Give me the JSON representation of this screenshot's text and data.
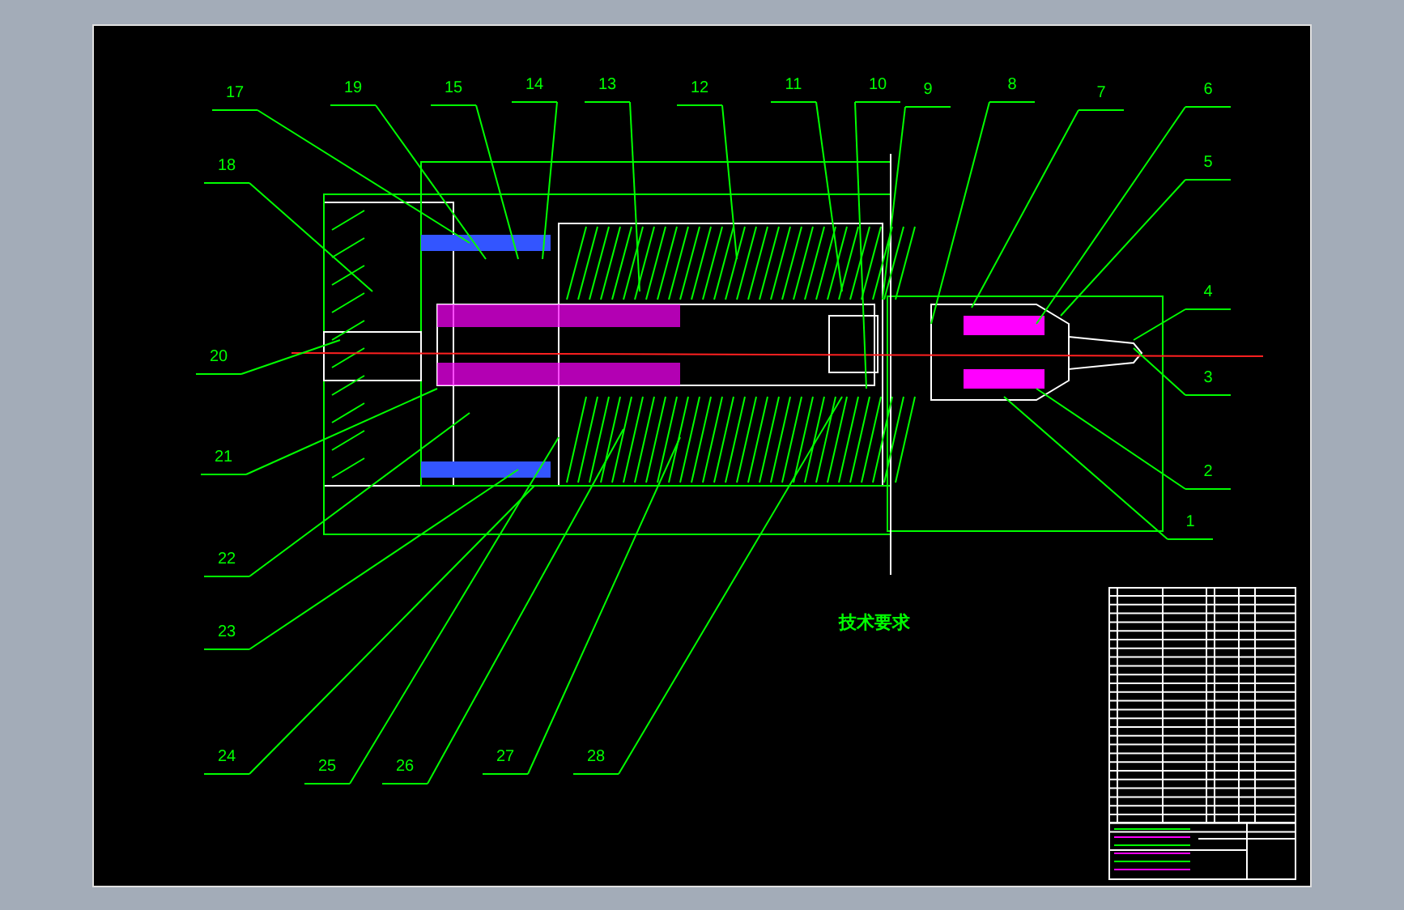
{
  "drawing": {
    "callouts": [
      {
        "label": "17"
      },
      {
        "label": "19"
      },
      {
        "label": "15"
      },
      {
        "label": "14"
      },
      {
        "label": "13"
      },
      {
        "label": "12"
      },
      {
        "label": "11"
      },
      {
        "label": "10"
      },
      {
        "label": "9"
      },
      {
        "label": "8"
      },
      {
        "label": "7"
      },
      {
        "label": "6"
      },
      {
        "label": "5"
      },
      {
        "label": "4"
      },
      {
        "label": "3"
      },
      {
        "label": "2"
      },
      {
        "label": "1"
      },
      {
        "label": "18"
      },
      {
        "label": "20"
      },
      {
        "label": "21"
      },
      {
        "label": "22"
      },
      {
        "label": "23"
      },
      {
        "label": "24"
      },
      {
        "label": "25"
      },
      {
        "label": "26"
      },
      {
        "label": "27"
      },
      {
        "label": "28"
      }
    ]
  },
  "notes": {
    "heading": "技术要求"
  }
}
